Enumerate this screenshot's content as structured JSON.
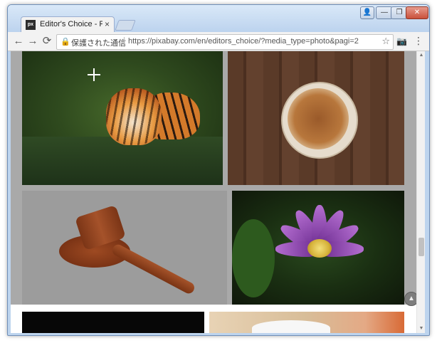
{
  "browser": {
    "tab": {
      "favicon_text": "px",
      "title": "Editor's Choice - Phot",
      "close_glyph": "×"
    },
    "window_controls": {
      "user": "👤",
      "minimize": "—",
      "maximize": "❐",
      "close": "✕"
    },
    "nav": {
      "back": "←",
      "forward": "→",
      "reload": "⟳"
    },
    "omnibox": {
      "lock": "🔒",
      "security_label": "保護された通信",
      "url": "https://pixabay.com/en/editors_choice/?media_type=photo&pagi=2",
      "star": "☆"
    },
    "camera_icon": "📷",
    "menu_icon": "⋮"
  },
  "page": {
    "photos": [
      {
        "name": "tiger-photo",
        "subject": "tiger in water"
      },
      {
        "name": "coffee-photo",
        "subject": "coffee cup on wooden table"
      },
      {
        "name": "gavel-photo",
        "subject": "wooden gavel"
      },
      {
        "name": "lotus-photo",
        "subject": "purple lotus flower"
      }
    ],
    "scroll_to_top_glyph": "▲"
  },
  "scrollbar": {
    "up": "▲",
    "down": "▼"
  }
}
